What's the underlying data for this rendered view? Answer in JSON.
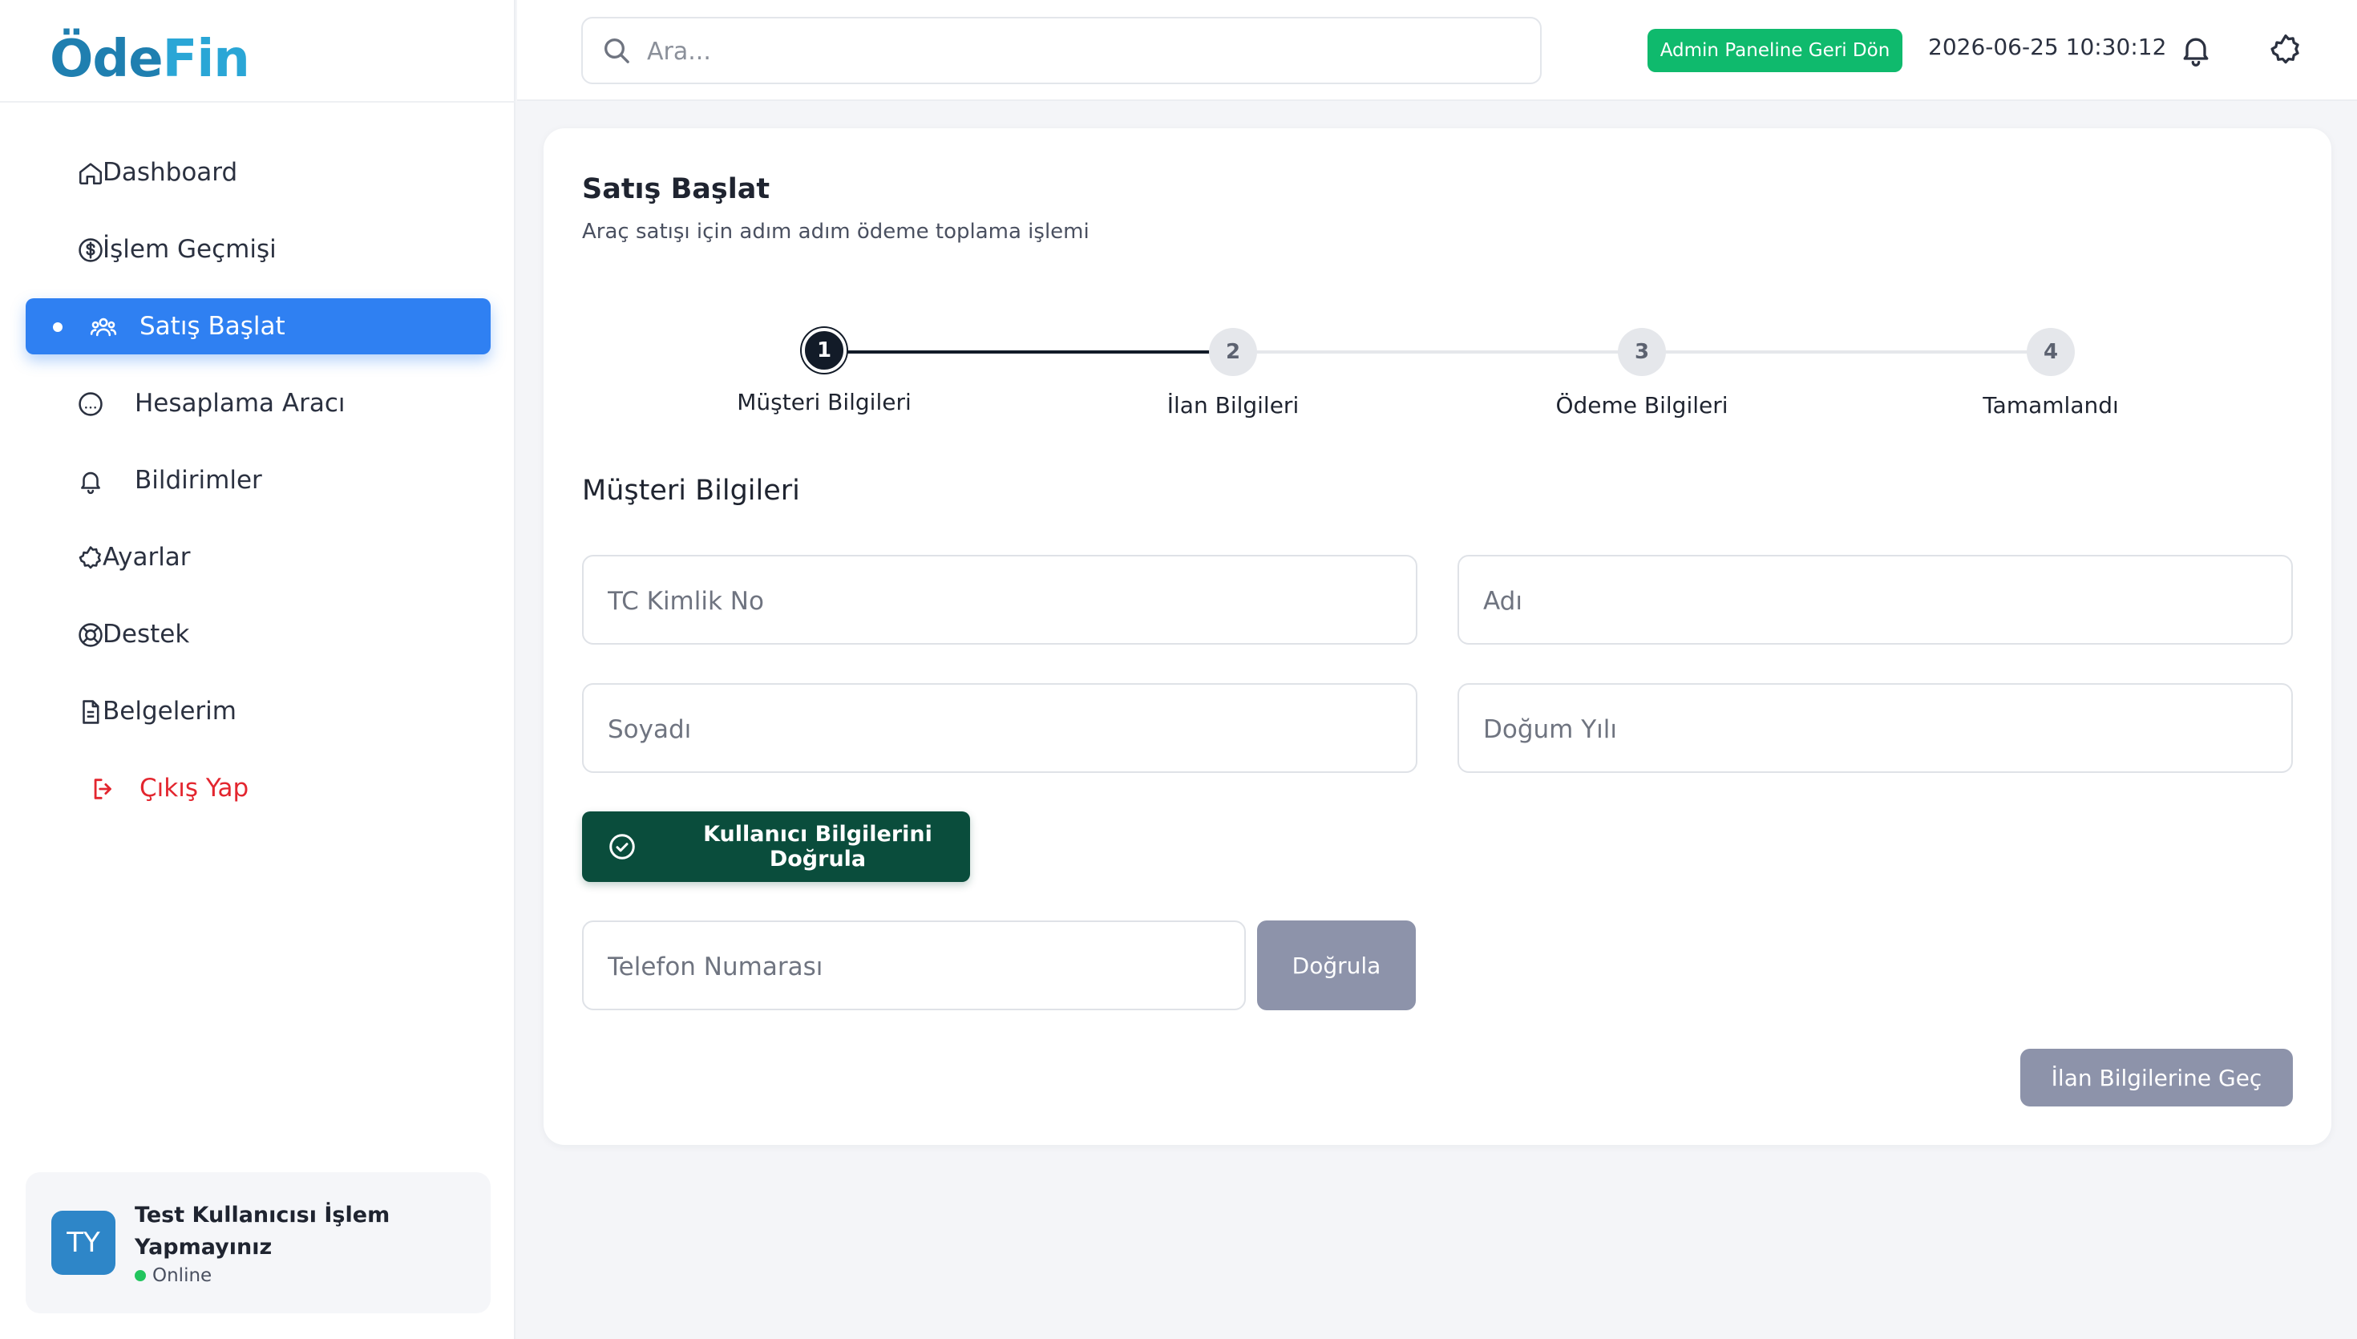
{
  "brand": {
    "name_main": "Öde",
    "name_accent": "Fin"
  },
  "search": {
    "placeholder": "Ara..."
  },
  "header": {
    "admin_button": "Admin Paneline Geri Dön",
    "datetime": "2026-06-25 10:30:12"
  },
  "sidebar": {
    "items": [
      {
        "label": "Dashboard",
        "icon": "home-icon"
      },
      {
        "label": "İşlem Geçmişi",
        "icon": "dollar-circle-icon"
      },
      {
        "label": "Satış Başlat",
        "icon": "users-icon",
        "active": true
      },
      {
        "label": "Hesaplama Aracı",
        "icon": "gauge-icon"
      },
      {
        "label": "Bildirimler",
        "icon": "bell-icon"
      },
      {
        "label": "Ayarlar",
        "icon": "gear-icon"
      },
      {
        "label": "Destek",
        "icon": "lifebuoy-icon"
      },
      {
        "label": "Belgelerim",
        "icon": "document-icon"
      },
      {
        "label": "Çıkış Yap",
        "icon": "logout-icon"
      }
    ]
  },
  "user": {
    "initials": "TY",
    "name": "Test Kullanıcısı İşlem Yapmayınız",
    "status": "Online"
  },
  "page": {
    "title": "Satış Başlat",
    "subtitle": "Araç satışı için adım adım ödeme toplama işlemi"
  },
  "steps": [
    {
      "number": "1",
      "label": "Müşteri Bilgileri",
      "state": "active"
    },
    {
      "number": "2",
      "label": "İlan Bilgileri",
      "state": "pending"
    },
    {
      "number": "3",
      "label": "Ödeme Bilgileri",
      "state": "pending"
    },
    {
      "number": "4",
      "label": "Tamamlandı",
      "state": "pending"
    }
  ],
  "form": {
    "section_title": "Müşteri Bilgileri",
    "tc_placeholder": "TC Kimlik No",
    "name_placeholder": "Adı",
    "surname_placeholder": "Soyadı",
    "birth_year_placeholder": "Doğum Yılı",
    "verify_user_button": "Kullanıcı Bilgilerini Doğrula",
    "phone_placeholder": "Telefon Numarası",
    "verify_phone_button": "Doğrula",
    "next_button": "İlan Bilgilerine Geç"
  },
  "colors": {
    "primary": "#2f80f2",
    "success": "#0fba6d",
    "dark_green": "#0a4d3c",
    "disabled": "#8d93aa",
    "danger": "#e3262f",
    "step_active": "#121b28"
  }
}
